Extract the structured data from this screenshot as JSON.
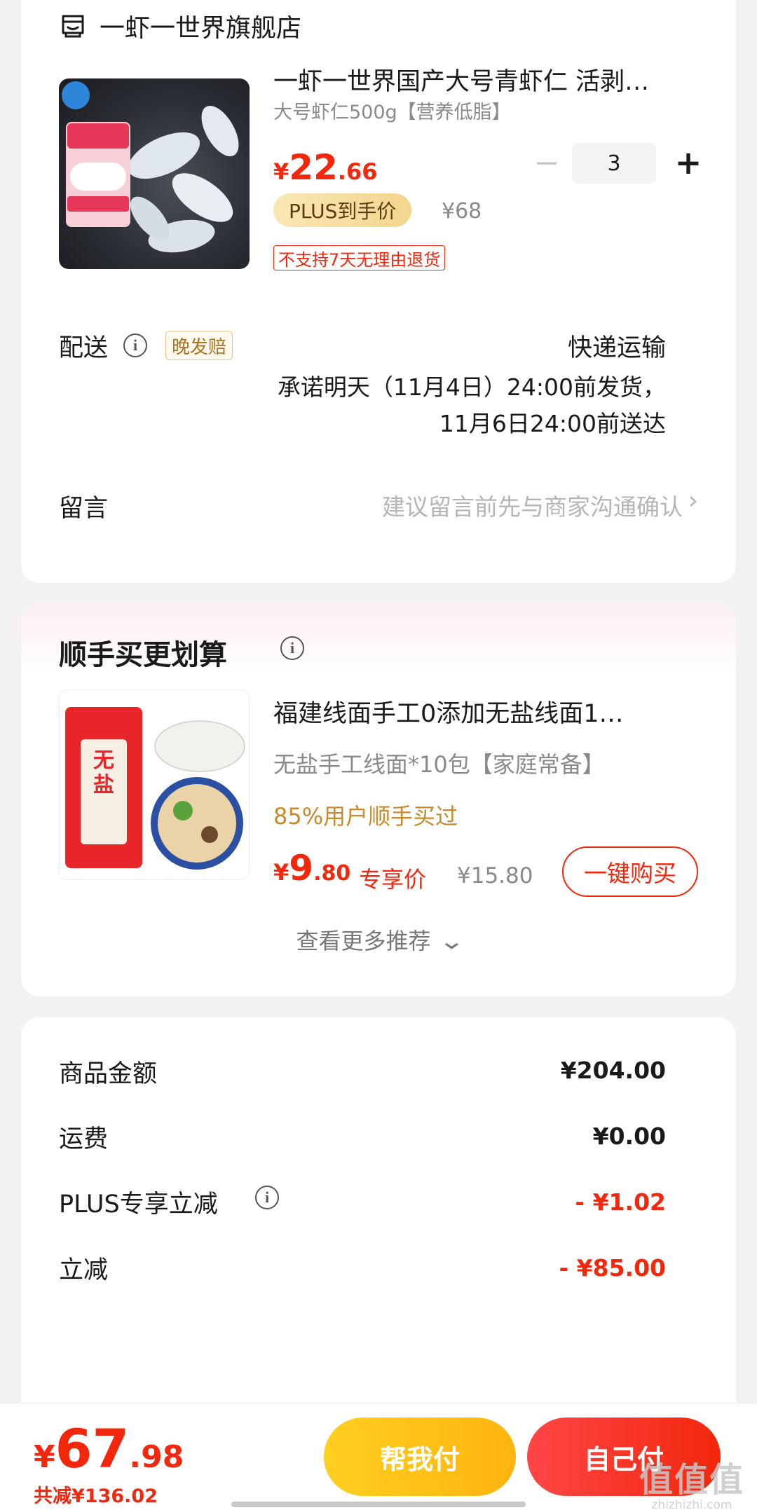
{
  "store": {
    "name": "一虾一世界旗舰店",
    "product": {
      "title": "一虾一世界国产大号青虾仁 活剥…",
      "spec": "大号虾仁500g【营养低脂】",
      "price_currency": "¥",
      "price_int": "22",
      "price_dec": ".66",
      "quantity": "3",
      "plus_badge": "PLUS到手价",
      "original_price": "¥68",
      "return_policy": "不支持7天无理由退货"
    },
    "delivery": {
      "label": "配送",
      "badge": "晚发赔",
      "method": "快递运输",
      "promise_line1": "承诺明天（11月4日）24:00前发货，",
      "promise_line2": "11月6日24:00前送达"
    },
    "message": {
      "label": "留言",
      "placeholder": "建议留言前先与商家沟通确认"
    }
  },
  "recommend": {
    "title": "顺手买更划算",
    "item": {
      "title": "福建线面手工0添加无盐线面1…",
      "spec": "无盐手工线面*10包【家庭常备】",
      "bought": "85%用户顺手买过",
      "price_currency": "¥",
      "price_int": "9",
      "price_dec": ".80",
      "price_tag": "专享价",
      "original_price": "¥15.80",
      "buy_button": "一键购买"
    },
    "more": "查看更多推荐"
  },
  "summary": {
    "rows": [
      {
        "label": "商品金额",
        "value": "¥204.00"
      },
      {
        "label": "运费",
        "value": "¥0.00"
      },
      {
        "label": "PLUS专享立减",
        "value": "- ¥1.02"
      },
      {
        "label": "立减",
        "value": "- ¥85.00"
      }
    ]
  },
  "bottom": {
    "total_currency": "¥",
    "total_int": "67",
    "total_dec": ".98",
    "saved": "共减¥136.02",
    "help_pay": "帮我付",
    "self_pay": "自己付"
  },
  "watermark": {
    "big": "值值值",
    "small": "zhizhizhi.com"
  },
  "icons": {
    "store": "store-icon",
    "info": "info-icon",
    "minus": "minus-icon",
    "plus": "plus-icon",
    "chevron_right": "chevron-right-icon",
    "chevron_down": "chevron-down-icon"
  },
  "colors": {
    "accent_red": "#f2270c",
    "plus_gold": "#f3d58d",
    "help_yellow": "#ffc21a",
    "bought_orange": "#c98a2b"
  }
}
